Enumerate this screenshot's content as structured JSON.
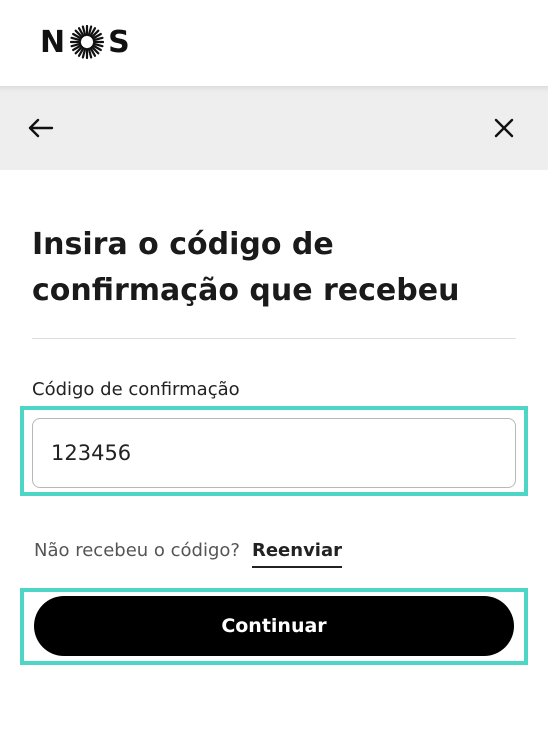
{
  "header": {
    "logo_letter_left": "N",
    "logo_letter_right": "S",
    "logo_icon": "sun-burst-icon"
  },
  "navbar": {
    "back_icon": "arrow-left-icon",
    "close_icon": "close-icon"
  },
  "main": {
    "title": "Insira o código de confirmação que recebeu",
    "field_label": "Código de confirmação",
    "field_value": "123456",
    "resend_question": "Não recebeu o código?",
    "resend_link": "Reenviar",
    "continue_label": "Continuar"
  },
  "colors": {
    "highlight": "#4dd6c6",
    "navbar_bg": "#eeeeee",
    "button_bg": "#000000"
  }
}
